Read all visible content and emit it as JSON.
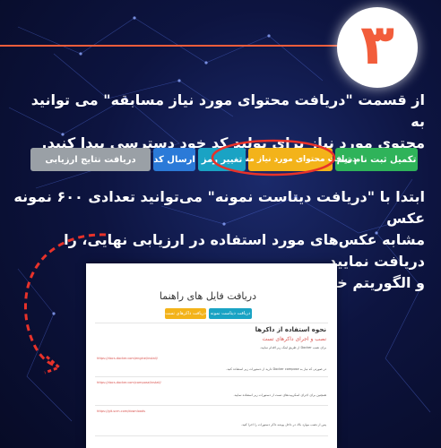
{
  "badge": {
    "number": "۳"
  },
  "intro": {
    "line1": "از قسمت \"دریافت محتوای مورد نیاز مسابقه\" می توانید به",
    "line2": "محتوی مورد نیاز برای تولید کد خود دسترسی پیدا کنید."
  },
  "buttons": [
    {
      "label": "تکمیل ثبت نام تیم",
      "color": "#2fb35a"
    },
    {
      "label": "دریافت محتوای مورد نیاز مسابقه",
      "color": "#f3b31a",
      "highlighted": true
    },
    {
      "label": "تغییر رمز",
      "color": "#1aa3c4"
    },
    {
      "label": "ارسال کد",
      "color": "#2b7ad8"
    },
    {
      "label": "دریافت نتایج ارزیابی",
      "color": "#9aa0a6"
    }
  ],
  "instruction": {
    "line1": "ابتدا با \"دریافت دیتاست نمونه\" می‌توانید تعدادی ۶۰۰ نمونه عکس",
    "line2": "مشابه عکس‌های مورد استفاده در ارزیابی نهایی، را دریافت نمایید",
    "line3": "و الگوریتم خود را با آنها تطبیق دهید."
  },
  "screenshot": {
    "title": "دریافت فایل های راهنما",
    "buttons": [
      {
        "label": "دریافت دیتاست نمونه",
        "color": "#1aa3c4"
      },
      {
        "label": "دریافت داکرهای تست",
        "color": "#f3b31a"
      }
    ],
    "heading": "نحوه استفاده از داکرها",
    "subheading": "نصب و اجرای داکرهای تست",
    "text_lines": [
      "برای نصب Docker از طریق لینک زیر اقدام نمایید.",
      "در صورتی که نیاز به Docker compose دارید از دستورات زیر استفاده کنید.",
      "همچنین برای اجرای اسکریپت‌های تست از دستورات زیر استفاده نمایید.",
      "پس از نصب موارد بالا، در داخل پوشه داکر دستورات را اجرا کنید."
    ],
    "links": [
      "https://docs.docker.com/engine/install/",
      "https://docs.docker.com/compose/install/",
      "https://git-scm.com/downloads"
    ]
  }
}
